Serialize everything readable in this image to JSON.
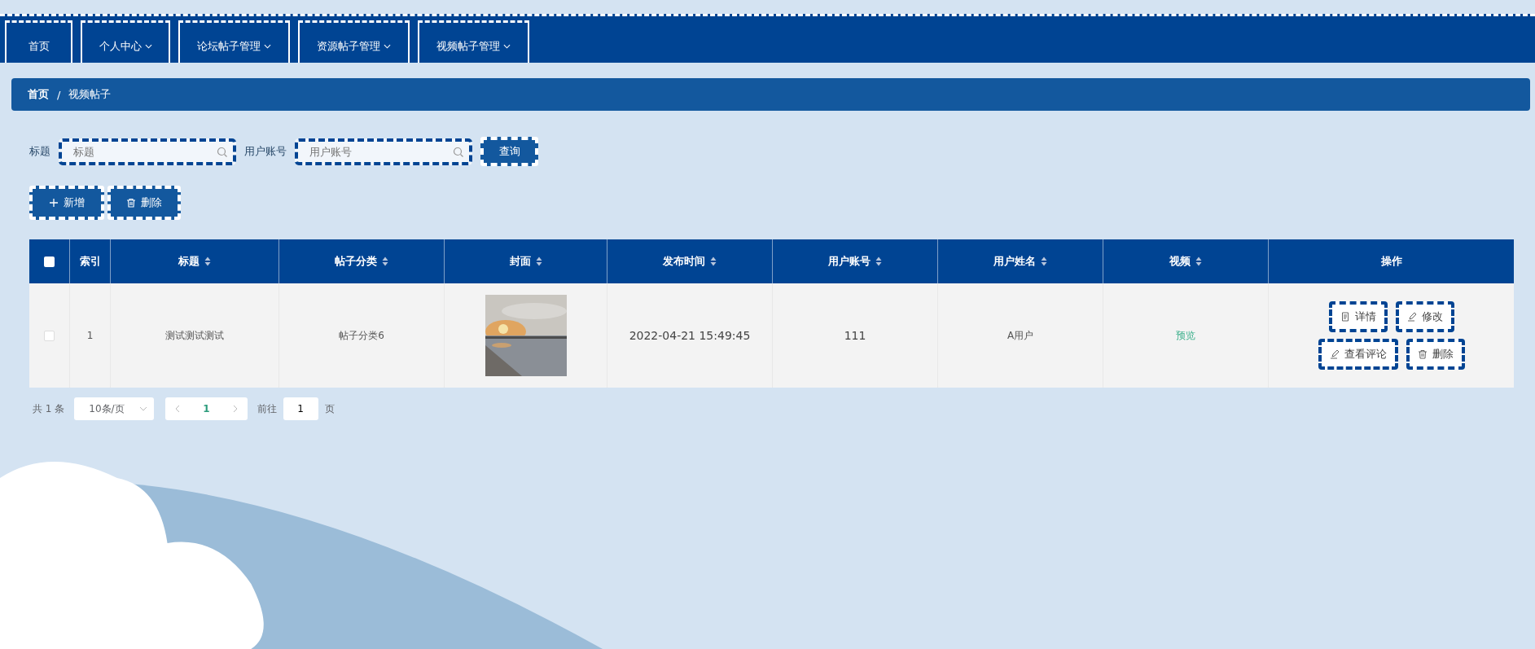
{
  "nav": [
    {
      "label": "首页",
      "dropdown": false
    },
    {
      "label": "个人中心",
      "dropdown": true
    },
    {
      "label": "论坛帖子管理",
      "dropdown": true
    },
    {
      "label": "资源帖子管理",
      "dropdown": true
    },
    {
      "label": "视频帖子管理",
      "dropdown": true
    }
  ],
  "breadcrumb": [
    "首页",
    "/",
    "视频帖子"
  ],
  "filters": [
    {
      "label": "标题",
      "placeholder": "标题"
    },
    {
      "label": "用户账号",
      "placeholder": "用户账号"
    }
  ],
  "search_button": "查询",
  "toolbar": [
    {
      "label": "新增",
      "kind": "add"
    },
    {
      "label": "删除",
      "kind": "delete"
    }
  ],
  "table": {
    "select_all": {
      "checked": false
    },
    "columns": [
      {
        "label": "索引",
        "sortable": false
      },
      {
        "label": "标题",
        "sortable": true
      },
      {
        "label": "帖子分类",
        "sortable": true
      },
      {
        "label": "封面",
        "sortable": true
      },
      {
        "label": "发布时间",
        "sortable": true
      },
      {
        "label": "用户账号",
        "sortable": true
      },
      {
        "label": "用户姓名",
        "sortable": true
      },
      {
        "label": "视频",
        "sortable": true
      },
      {
        "label": "操作",
        "sortable": false
      }
    ],
    "rows": [
      {
        "checked": false,
        "index": "1",
        "title": "测试测试测试",
        "category": "帖子分类6",
        "cover": {
          "kind": "picture"
        },
        "time": "2022-04-21 15:49:45",
        "account": "111",
        "name": "A用户",
        "video": "预览",
        "actions": [
          {
            "label": "详情",
            "kind": "detail"
          },
          {
            "label": "修改",
            "kind": "edit"
          },
          {
            "label": "查看评论",
            "kind": "comments"
          },
          {
            "label": "删除",
            "kind": "delete"
          }
        ]
      }
    ]
  },
  "pagination": {
    "total": "共 1 条",
    "page_size": "10条/页",
    "pages": [
      {
        "label": "1",
        "selected": true
      }
    ],
    "goto_label": "前往",
    "goto_value": "1",
    "goto_suffix": "页"
  }
}
